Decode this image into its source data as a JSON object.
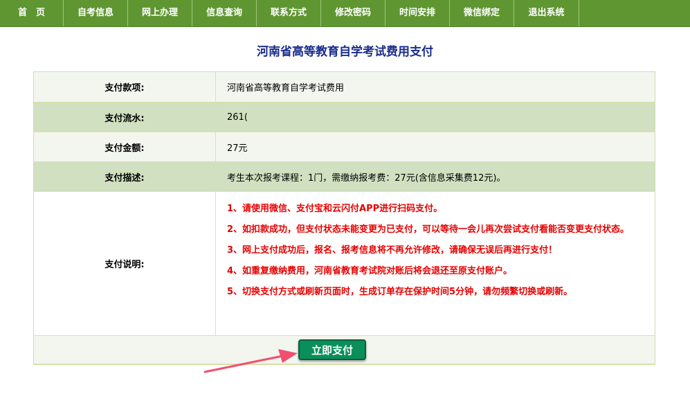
{
  "nav": {
    "items": [
      "首　页",
      "自考信息",
      "网上办理",
      "信息查询",
      "联系方式",
      "修改密码",
      "时间安排",
      "微信绑定",
      "退出系统"
    ]
  },
  "page_title": "河南省高等教育自学考试费用支付",
  "rows": {
    "item": {
      "label": "支付款项:",
      "value": "河南省高等教育自学考试费用"
    },
    "serial": {
      "label": "支付流水:",
      "value": "261("
    },
    "amount": {
      "label": "支付金额:",
      "value": "27元"
    },
    "desc": {
      "label": "支付描述:",
      "value": "考生本次报考课程：1门，需缴纳报考费：27元(含信息采集费12元)。"
    },
    "notes": {
      "label": "支付说明:",
      "lines": [
        "1、请使用微信、支付宝和云闪付APP进行扫码支付。",
        "2、如扣款成功，但支付状态未能变更为已支付，可以等待一会儿再次尝试支付看能否变更支付状态。",
        "3、网上支付成功后，报名、报考信息将不再允许修改，请确保无误后再进行支付！",
        "4、如重复缴纳费用，河南省教育考试院对账后将会退还至原支付账户。",
        "5、切换支付方式或刷新页面时，生成订单存在保护时间5分钟，请勿频繁切换或刷新。"
      ]
    }
  },
  "pay_button": "立即支付",
  "colors": {
    "nav": "#5f9632",
    "title": "#1a2c8c",
    "note_red": "#e60000",
    "button": "#0a8f5a",
    "arrow": "#f0506e"
  }
}
